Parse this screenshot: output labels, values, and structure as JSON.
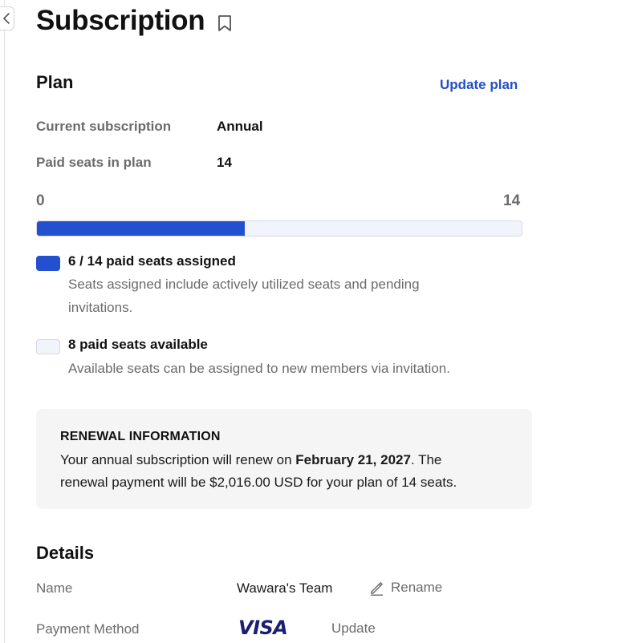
{
  "page": {
    "title": "Subscription"
  },
  "plan": {
    "heading": "Plan",
    "update_link": "Update plan",
    "current_subscription_label": "Current subscription",
    "current_subscription_value": "Annual",
    "paid_seats_label": "Paid seats in plan",
    "paid_seats_value": "14",
    "range_min": "0",
    "range_max": "14",
    "seats_assigned": 6,
    "seats_total": 14,
    "assigned_title": "6 / 14 paid seats assigned",
    "assigned_desc_line1": "Seats assigned include actively utilized seats and pending",
    "assigned_desc_line2": "invitations.",
    "available_title": "8 paid seats available",
    "available_desc": "Available seats can be assigned to new members via invitation.",
    "colors": {
      "assigned": "#2250cf",
      "available": "#f1f4fb",
      "link": "#2350c7"
    }
  },
  "renewal": {
    "heading": "RENEWAL INFORMATION",
    "text_before_date": "Your annual subscription will renew on ",
    "date": "February 21, 2027",
    "text_after_date": ". The",
    "text_line2": "renewal payment will be $2,016.00 USD for your plan of 14 seats."
  },
  "details": {
    "heading": "Details",
    "name_label": "Name",
    "name_value": "Wawara's Team",
    "rename_label": "Rename",
    "payment_label": "Payment Method",
    "payment_brand": "VISA",
    "update_label": "Update"
  },
  "icons": {
    "collapse": "chevron-left-icon",
    "bookmark": "bookmark-icon",
    "rename": "pencil-icon",
    "payment": "visa-logo"
  }
}
